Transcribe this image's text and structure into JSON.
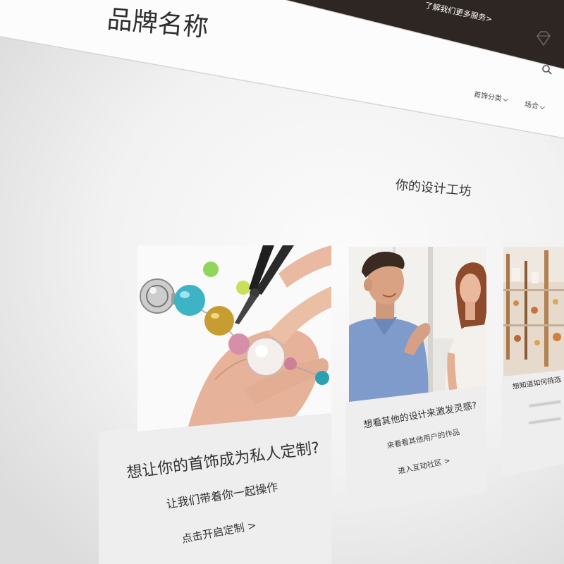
{
  "brand": {
    "name": "品牌名称"
  },
  "top_banner": {
    "link_text": "了解我们更多服务>"
  },
  "header": {
    "icons": [
      "diamond-icon",
      "search-icon"
    ]
  },
  "nav": {
    "items": [
      {
        "label": "首饰分类",
        "icon": "chevron-down-icon"
      },
      {
        "label": "场合",
        "icon": "chevron-down-icon"
      }
    ]
  },
  "workshop": {
    "title": "你的设计工坊",
    "cards": [
      {
        "title": "想让你的首饰成为私人定制?",
        "subtitle": "让我们带着你一起操作",
        "link": "点击开启定制 >"
      },
      {
        "title": "想看其他的设计来激发灵感?",
        "subtitle": "来看看其他用户的作品",
        "link": "进入互动社区 >"
      },
      {
        "title": "想知道如何挑选"
      }
    ]
  },
  "colors": {
    "text": "#333333",
    "banner": "#2d2622",
    "banner_text": "#ffffff",
    "panel": "#eeeeee",
    "divider": "#d6d6d6"
  }
}
